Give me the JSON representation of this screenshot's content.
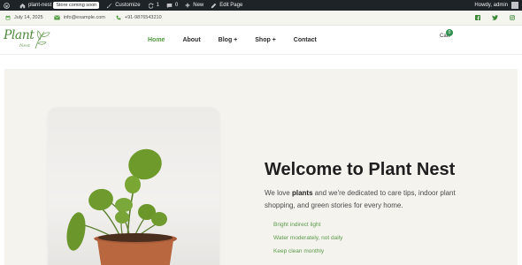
{
  "admin_bar": {
    "site_name": "plant-nest",
    "store_badge": "Store coming soon",
    "customize": "Customize",
    "updates_count": "1",
    "comments_count": "0",
    "new_label": "New",
    "edit_page": "Edit Page",
    "howdy": "Howdy, admin"
  },
  "info_bar": {
    "date": "July 14, 2025",
    "email": "info@example.com",
    "phone": "+91-9876543210",
    "social_icons": [
      "facebook-icon",
      "twitter-icon",
      "instagram-icon"
    ]
  },
  "header": {
    "logo_title": "Plant",
    "logo_subtitle": "Nest",
    "nav": [
      {
        "label": "Home",
        "active": true
      },
      {
        "label": "About"
      },
      {
        "label": "Blog +"
      },
      {
        "label": "Shop +"
      },
      {
        "label": "Contact"
      }
    ],
    "cart_label": "Cart",
    "cart_count": "0"
  },
  "hero": {
    "title": "Welcome to Plant Nest",
    "desc_prefix": "We love ",
    "desc_bold": "plants",
    "desc_suffix": " and we're dedicated to care tips, indoor plant shopping, and green stories for every home.",
    "tips": [
      "Bright indirect light",
      "Water moderately, not daily",
      "Keep clean monthly"
    ]
  },
  "colors": {
    "accent_green": "#4f9a3f",
    "admin_bar_bg": "#1d2327",
    "hero_bg": "#f4f3ee",
    "cart_badge": "#2f8f4e"
  }
}
